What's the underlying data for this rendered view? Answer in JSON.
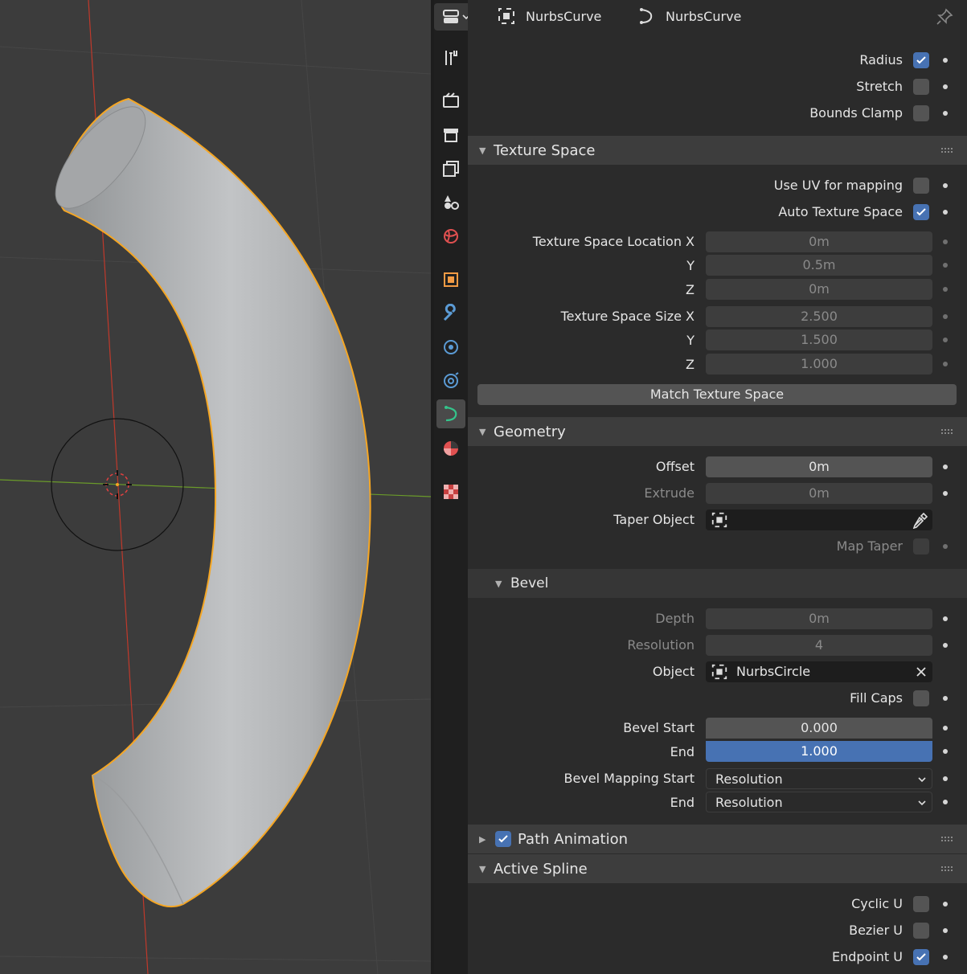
{
  "header": {
    "object_name": "NurbsCurve",
    "data_name": "NurbsCurve"
  },
  "shape": {
    "radius": {
      "label": "Radius",
      "checked": true
    },
    "stretch": {
      "label": "Stretch",
      "checked": false
    },
    "bounds_clamp": {
      "label": "Bounds Clamp",
      "checked": false
    }
  },
  "texture_space": {
    "title": "Texture Space",
    "use_uv": {
      "label": "Use UV for mapping",
      "checked": false
    },
    "auto": {
      "label": "Auto Texture Space",
      "checked": true
    },
    "location_label": "Texture Space Location X",
    "location": {
      "x": "0m",
      "y_label": "Y",
      "y": "0.5m",
      "z_label": "Z",
      "z": "0m"
    },
    "size_label": "Texture Space Size X",
    "size": {
      "x": "2.500",
      "y_label": "Y",
      "y": "1.500",
      "z_label": "Z",
      "z": "1.000"
    },
    "match_button": "Match Texture Space"
  },
  "geometry": {
    "title": "Geometry",
    "offset_label": "Offset",
    "offset": "0m",
    "extrude_label": "Extrude",
    "extrude": "0m",
    "taper_label": "Taper Object",
    "map_taper_label": "Map Taper"
  },
  "bevel": {
    "title": "Bevel",
    "depth_label": "Depth",
    "depth": "0m",
    "resolution_label": "Resolution",
    "resolution": "4",
    "object_label": "Object",
    "object": "NurbsCircle",
    "fill_caps_label": "Fill Caps",
    "bevel_start_label": "Bevel Start",
    "bevel_start": "0.000",
    "end_label": "End",
    "bevel_end": "1.000",
    "mapping_start_label": "Bevel Mapping Start",
    "mapping_start": "Resolution",
    "mapping_end_label": "End",
    "mapping_end": "Resolution"
  },
  "path_animation": {
    "title": "Path Animation",
    "checked": true
  },
  "active_spline": {
    "title": "Active Spline",
    "cyclic_u": {
      "label": "Cyclic U",
      "checked": false
    },
    "bezier_u": {
      "label": "Bezier U",
      "checked": false
    },
    "endpoint_u": {
      "label": "Endpoint U",
      "checked": true
    }
  },
  "colors": {
    "accent": "#4772b3",
    "selection_outline": "#f5a623",
    "x_axis": "#c0392b",
    "y_axis": "#6a9a2a"
  },
  "tab_icons": [
    "tool-icon",
    "render-icon",
    "output-icon",
    "view-layer-icon",
    "scene-icon",
    "world-icon",
    "object-icon",
    "modifier-icon",
    "particles-icon",
    "physics-icon",
    "curve-data-icon",
    "material-icon",
    "texture-icon"
  ]
}
